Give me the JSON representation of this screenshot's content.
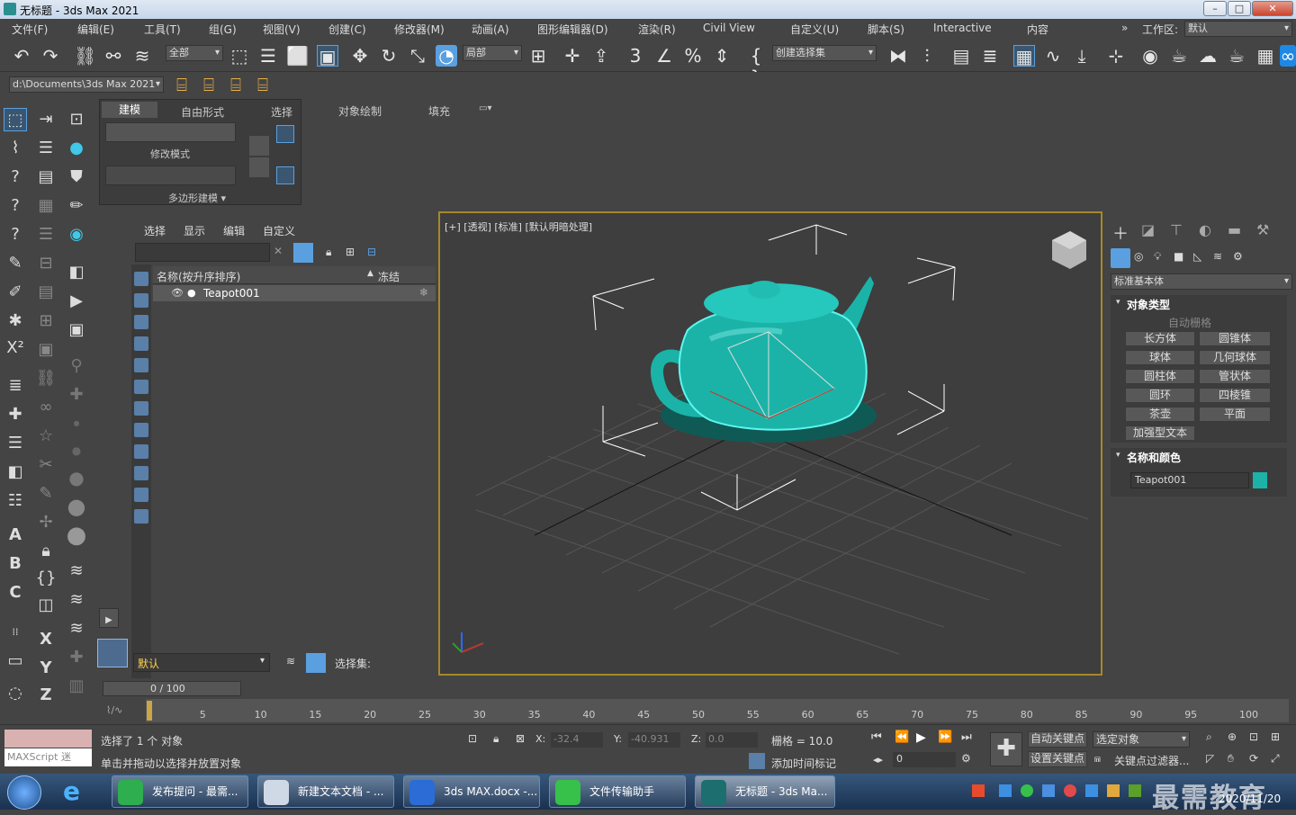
{
  "window": {
    "title": "无标题 - 3ds Max 2021"
  },
  "menu": [
    "文件(F)",
    "编辑(E)",
    "工具(T)",
    "组(G)",
    "视图(V)",
    "创建(C)",
    "修改器(M)",
    "动画(A)",
    "图形编辑器(D)",
    "渲染(R)",
    "Civil View",
    "自定义(U)",
    "脚本(S)",
    "Interactive",
    "内容"
  ],
  "workspace": {
    "label": "工作区:",
    "value": "默认"
  },
  "toolbar": {
    "filter": "全部",
    "coord": "局部",
    "selset": "创建选择集"
  },
  "path": {
    "value": "d:\\Documents\\3ds Max 2021"
  },
  "ribbon": {
    "tabs": [
      "建模",
      "自由形式",
      "选择",
      "对象绘制",
      "填充"
    ],
    "modify_mode": "修改模式",
    "poly_modeling": "多边形建模 ▾"
  },
  "explorer": {
    "tabs": [
      "选择",
      "显示",
      "编辑",
      "自定义"
    ],
    "col_name": "名称(按升序排序)",
    "col_freeze": "冻结",
    "object": "Teapot001",
    "layer": "默认",
    "selset_label": "选择集:"
  },
  "viewport": {
    "label": "[+] [透视] [标准] [默认明暗处理]"
  },
  "command_panel": {
    "dropdown": "标准基本体",
    "rollout1": "对象类型",
    "autogrid": "自动栅格",
    "buttons": [
      "长方体",
      "圆锥体",
      "球体",
      "几何球体",
      "圆柱体",
      "管状体",
      "圆环",
      "四棱锥",
      "茶壶",
      "平面",
      "加强型文本"
    ],
    "rollout2": "名称和颜色",
    "name": "Teapot001",
    "color": "#1bb3a8"
  },
  "timeline": {
    "frame_display": "0 / 100",
    "ticks": [
      "5",
      "10",
      "15",
      "20",
      "25",
      "30",
      "35",
      "40",
      "45",
      "50",
      "55",
      "60",
      "65",
      "70",
      "75",
      "80",
      "85",
      "90",
      "95",
      "100"
    ]
  },
  "status": {
    "maxscript": "MAXScript 迷",
    "selected": "选择了 1 个 对象",
    "hint": "单击并拖动以选择并放置对象",
    "x": "-32.4",
    "y": "-40.931",
    "z": "0.0",
    "grid": "栅格 = 10.0",
    "add_tag": "添加时间标记",
    "auto_key": "自动关键点",
    "set_key": "设置关键点",
    "sel_obj": "选定对象",
    "key_filter": "关键点过滤器...",
    "frame": "0"
  },
  "taskbar": {
    "tasks": [
      "发布提问 - 最需...",
      "新建文本文档 - ...",
      "3ds MAX.docx -...",
      "文件传输助手",
      "无标题 - 3ds Ma..."
    ],
    "date": "2020/11/20",
    "watermark": "最需教育"
  }
}
